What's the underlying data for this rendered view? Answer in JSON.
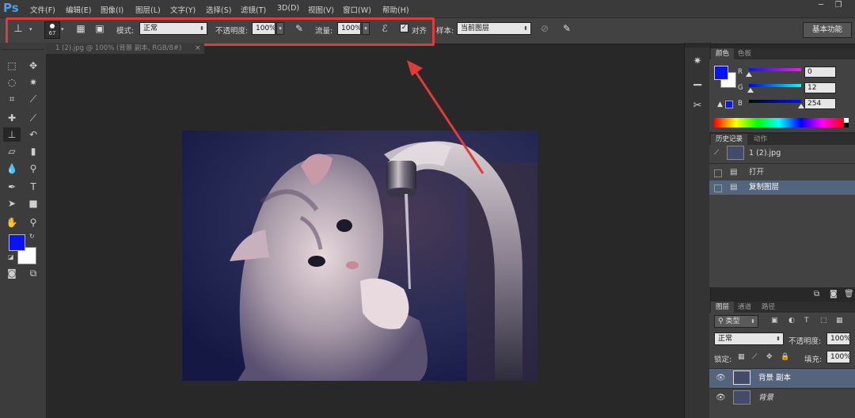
{
  "app": {
    "logo": "Ps",
    "menu": [
      "文件(F)",
      "编辑(E)",
      "图像(I)",
      "图层(L)",
      "文字(Y)",
      "选择(S)",
      "滤镜(T)",
      "3D(D)",
      "视图(V)",
      "窗口(W)",
      "帮助(H)"
    ]
  },
  "options_bar": {
    "brush_size": "67",
    "mode_label": "模式:",
    "mode_value": "正常",
    "opacity_label": "不透明度:",
    "opacity_value": "100%",
    "flow_label": "流量:",
    "flow_value": "100%",
    "align_label": "对齐",
    "align_checked": "✓",
    "sample_label": "样本:",
    "sample_value": "当前图层",
    "workspace": "基本功能"
  },
  "document": {
    "tab_title": "1 (2).jpg @ 100% (背景 副本, RGB/8#)",
    "tab_close": "×"
  },
  "colors": {
    "foreground": "#0a14f0",
    "background": "#ffffff",
    "highlight": "#e03a3a"
  },
  "color_panel": {
    "tabs": [
      "颜色",
      "色板"
    ],
    "channels": [
      {
        "label": "R",
        "value": "0"
      },
      {
        "label": "G",
        "value": "12"
      },
      {
        "label": "B",
        "value": "254"
      }
    ]
  },
  "history_panel": {
    "tabs": [
      "历史记录",
      "动作"
    ],
    "snapshot": "1 (2).jpg",
    "items": [
      "打开",
      "复制图层"
    ]
  },
  "layers_panel": {
    "tabs": [
      "图层",
      "通道",
      "路径"
    ],
    "filter_kind": "类型",
    "blend_mode": "正常",
    "opacity_label": "不透明度:",
    "opacity_value": "100%",
    "lock_label": "锁定:",
    "fill_label": "填充:",
    "fill_value": "100%",
    "layers": [
      {
        "name": "背景 副本",
        "selected": true
      },
      {
        "name": "背景",
        "selected": false
      }
    ]
  }
}
